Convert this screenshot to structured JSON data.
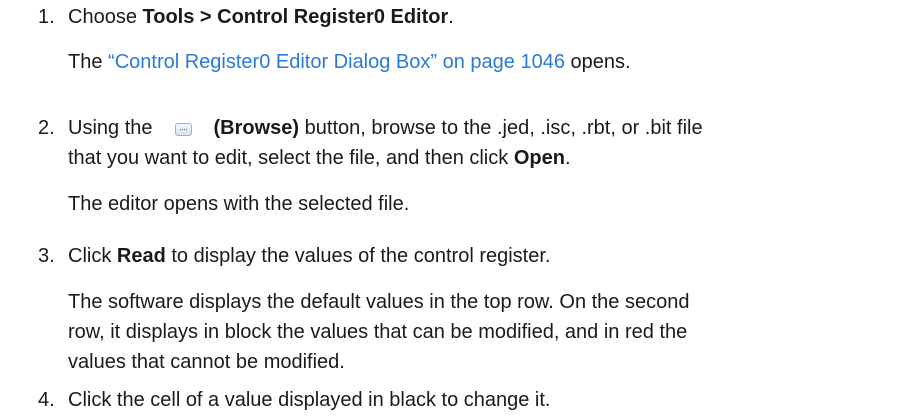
{
  "steps": [
    {
      "num": "1.",
      "pre": "Choose ",
      "bold": "Tools > Control Register0 Editor",
      "post": ".",
      "result_link": "“Control Register0 Editor Dialog Box” on page 1046",
      "result_post": " opens."
    },
    {
      "num": "2.",
      "pre": "Using the",
      "icon": "browse-button-icon",
      "bold": "(Browse)",
      "post": " button, browse to the .jed, .isc, .rbt, or .bit file",
      "line2_pre": "that you want to edit, select the file, and then click ",
      "line2_bold": "Open",
      "line2_post": ".",
      "result": "The editor opens with the selected file."
    },
    {
      "num": "3.",
      "pre": "Click ",
      "bold": "Read",
      "post": " to display the values of the control register.",
      "result_lines": [
        "The software displays the default values in the top row. On the second",
        "row, it displays in block the values that can be modified, and in red the",
        "values that cannot be modified."
      ]
    },
    {
      "num": "4.",
      "text": "Click the cell of a value displayed in black to change it."
    }
  ],
  "result_prefix": "The ",
  "colors": {
    "text": "#1a1a1a",
    "link": "#2a7ad8"
  }
}
